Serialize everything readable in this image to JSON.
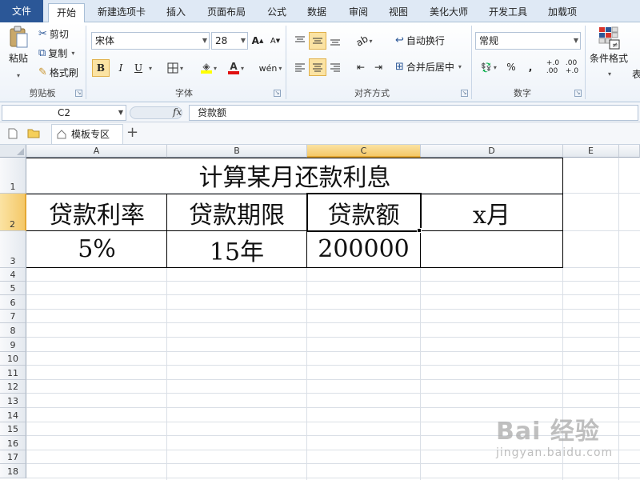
{
  "tabs": [
    "文件",
    "开始",
    "新建选项卡",
    "插入",
    "页面布局",
    "公式",
    "数据",
    "审阅",
    "视图",
    "美化大师",
    "开发工具",
    "加载项"
  ],
  "clipboard": {
    "paste": "粘贴",
    "cut": "剪切",
    "copy": "复制",
    "format_painter": "格式刷",
    "label": "剪贴板"
  },
  "font": {
    "name": "宋体",
    "size": "28",
    "bold": "B",
    "italic": "I",
    "underline": "U",
    "label": "字体"
  },
  "alignment": {
    "wrap": "自动换行",
    "merge": "合并后居中",
    "label": "对齐方式"
  },
  "number": {
    "format": "常规",
    "percent": "%",
    "comma": ",",
    "label": "数字"
  },
  "styles": {
    "conditional": "条件格式",
    "table": "表"
  },
  "formula_bar": {
    "name_box": "C2",
    "fx": "fx",
    "content": "贷款额"
  },
  "workbook_tabs": {
    "template_tab": "模板专区",
    "add": "+"
  },
  "columns": [
    "A",
    "B",
    "C",
    "D",
    "E"
  ],
  "rows": [
    "1",
    "2",
    "3",
    "4",
    "5",
    "6",
    "7",
    "8",
    "9",
    "10",
    "11",
    "12",
    "13",
    "14",
    "15",
    "16",
    "17",
    "18"
  ],
  "sheet": {
    "title": "计算某月还款利息",
    "headers": [
      "贷款利率",
      "贷款期限",
      "贷款额",
      "x月"
    ],
    "values": [
      "5%",
      "15年",
      "200000",
      ""
    ]
  },
  "watermark": {
    "brand": "Bai 经验",
    "url": "jingyan.baidu.com"
  }
}
